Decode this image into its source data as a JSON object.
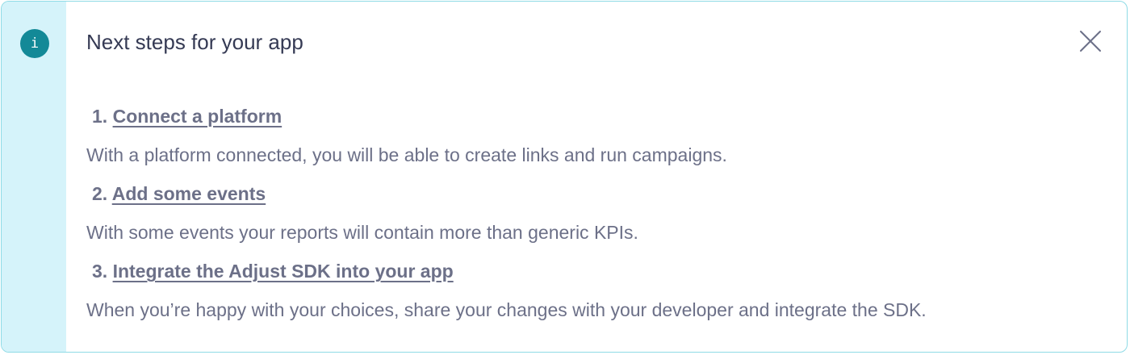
{
  "banner": {
    "icon": "info-icon",
    "icon_glyph": "i",
    "title": "Next steps for your app",
    "close_icon": "close-icon",
    "accent_color": "#138997",
    "rail_color": "#d5f3fa"
  },
  "steps": [
    {
      "number": "1.",
      "link": "Connect a platform",
      "description": "With a platform connected, you will be able to create links and run campaigns."
    },
    {
      "number": "2.",
      "link": "Add some events",
      "description": "With some events your reports will contain more than generic KPIs."
    },
    {
      "number": "3.",
      "link": "Integrate the Adjust SDK into your app",
      "description": "When you’re happy with your choices, share your changes with your developer and integrate the SDK."
    }
  ]
}
